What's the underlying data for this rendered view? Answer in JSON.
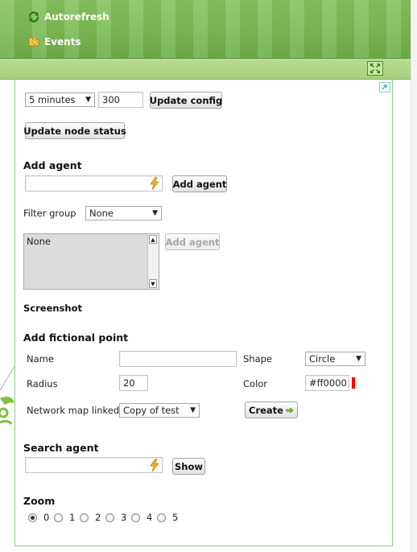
{
  "menu": {
    "autorefresh_label": "Autorefresh",
    "events_label": "Events"
  },
  "refresh": {
    "interval_selected": "5 minutes",
    "interval_seconds": "300",
    "update_config_label": "Update config",
    "update_node_status_label": "Update node status"
  },
  "add_agent": {
    "title": "Add agent",
    "input_value": "",
    "button_label": "Add agent",
    "filter_group_label": "Filter group",
    "filter_group_value": "None",
    "list_options": [
      "None"
    ],
    "list_add_button_label": "Add agent"
  },
  "screenshot": {
    "title": "Screenshot"
  },
  "fictional_point": {
    "title": "Add fictional point",
    "name_label": "Name",
    "name_value": "",
    "shape_label": "Shape",
    "shape_value": "Circle",
    "radius_label": "Radius",
    "radius_value": "20",
    "color_label": "Color",
    "color_value": "#ff0000",
    "network_map_label": "Network map linked",
    "network_map_value": "Copy of test",
    "create_label": "Create"
  },
  "search_agent": {
    "title": "Search agent",
    "input_value": "",
    "show_label": "Show"
  },
  "zoom": {
    "title": "Zoom",
    "levels": [
      "0",
      "1",
      "2",
      "3",
      "4",
      "5"
    ],
    "selected": "0"
  },
  "colors": {
    "menu_green": "#7cba54",
    "toolbar_green": "#a6d07c",
    "panel_border": "#8fcf7f",
    "swatch": "#ff0000",
    "icon_green": "#4a9a1e",
    "bolt_yellow": "#f0b020"
  }
}
